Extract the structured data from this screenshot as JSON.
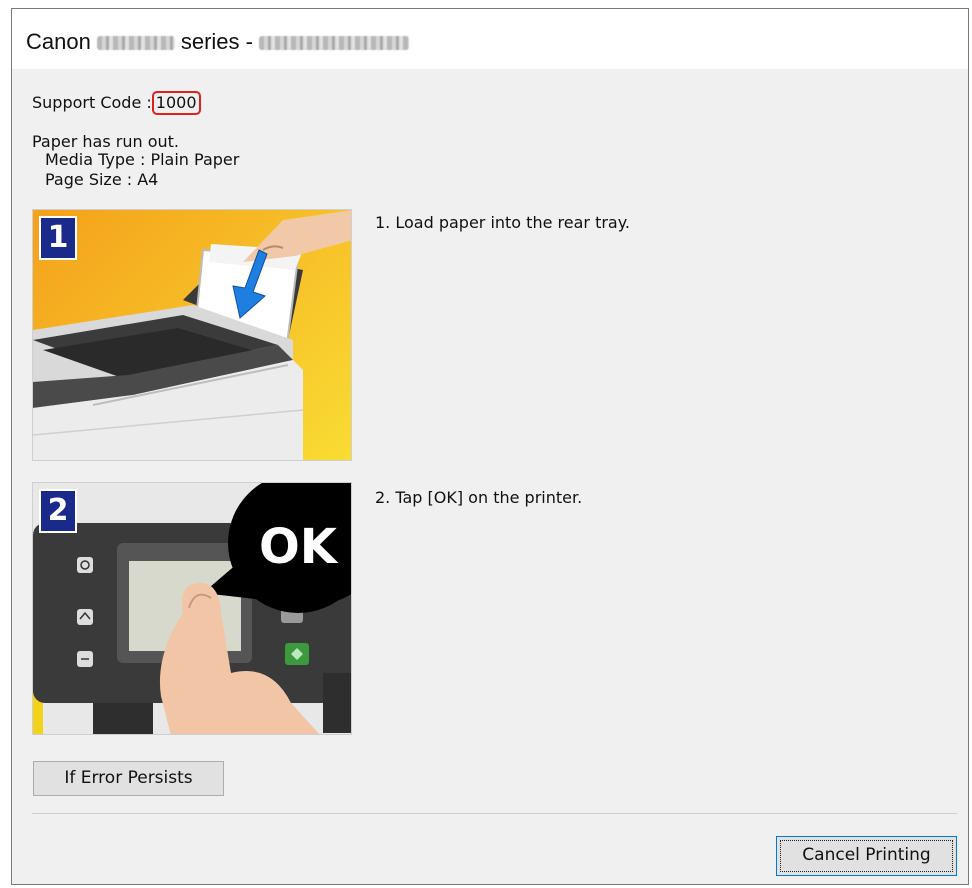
{
  "window": {
    "title_brand": "Canon",
    "title_series": "series -"
  },
  "support": {
    "label": "Support Code :",
    "code": "1000"
  },
  "message": {
    "line1": "Paper has run out.",
    "media_type": "Media Type : Plain Paper",
    "page_size": "Page Size : A4"
  },
  "steps": [
    {
      "badge": "1",
      "text": "1.  Load paper into the rear tray."
    },
    {
      "badge": "2",
      "text": "2.  Tap [OK] on the printer.",
      "bubble_text": "OK"
    }
  ],
  "buttons": {
    "if_error": "If Error Persists",
    "cancel": "Cancel Printing"
  },
  "colors": {
    "highlight_box": "#e0201c",
    "badge": "#1a2a8a",
    "step1_bg": "#f4a11b",
    "focus_border": "#0078d7"
  }
}
